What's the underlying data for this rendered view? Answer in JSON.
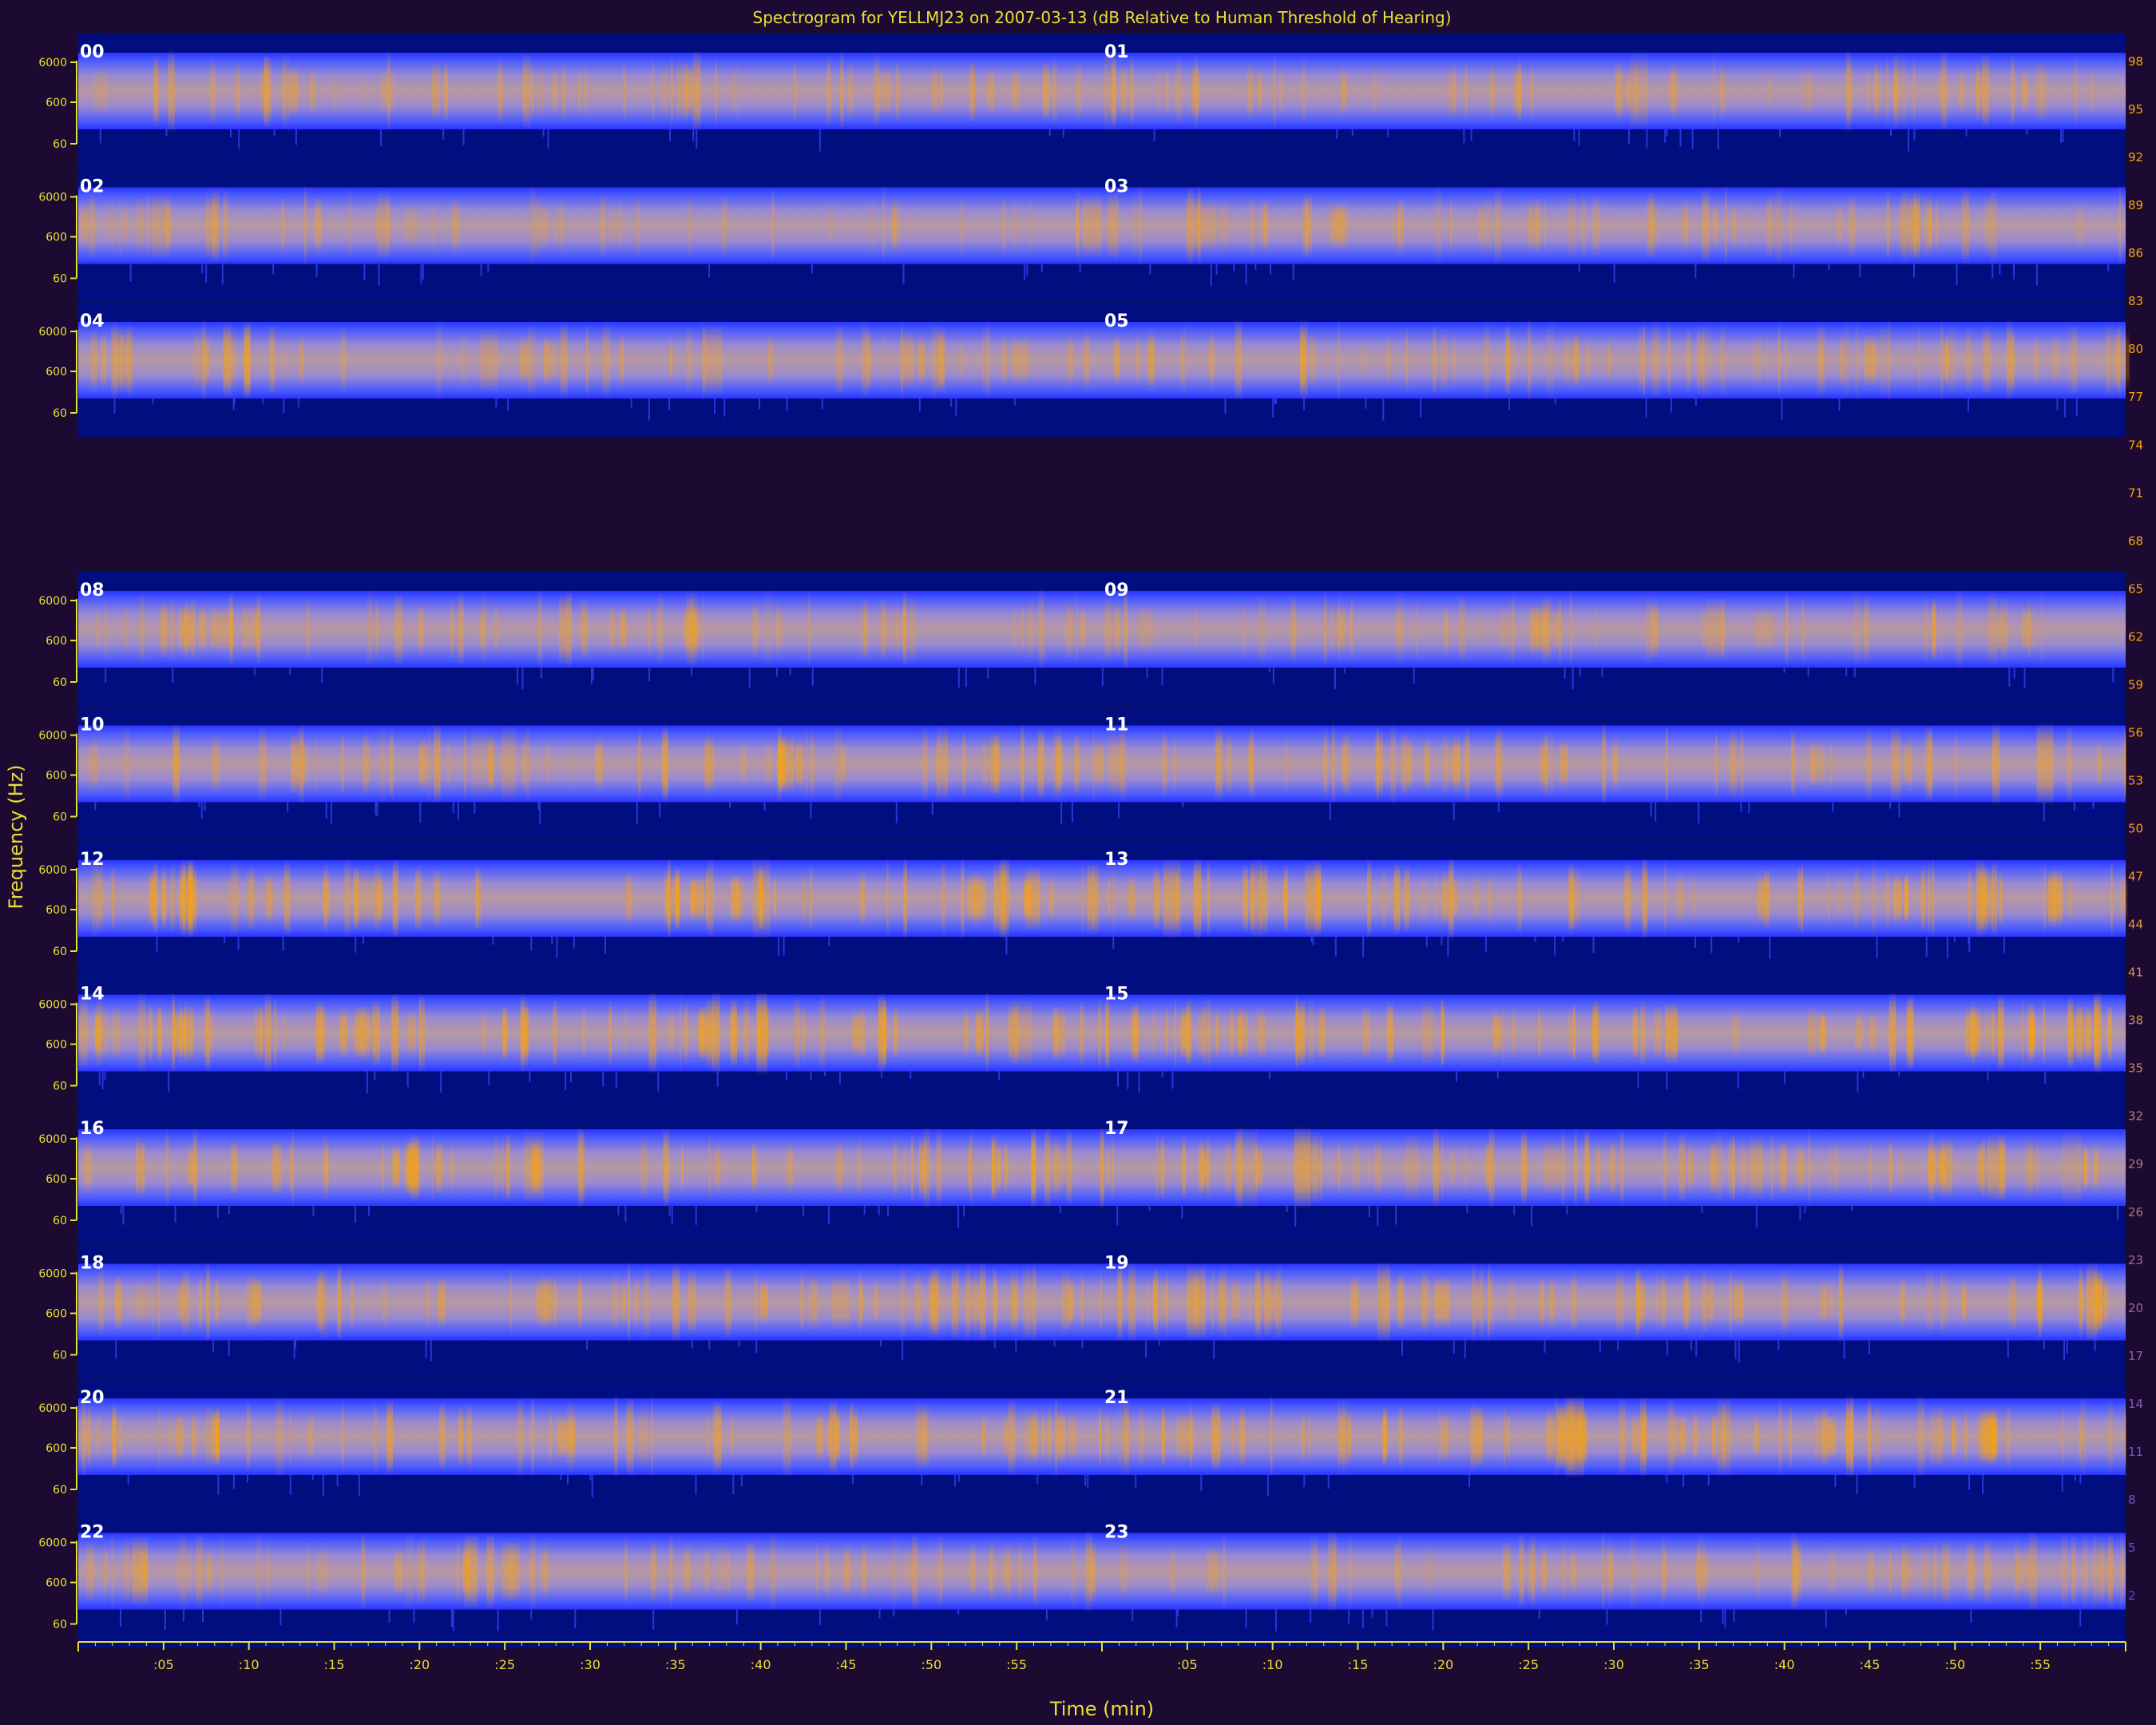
{
  "chart_data": {
    "type": "heatmap",
    "title": "Spectrogram for YELLMJ23 on 2007-03-13 (dB Relative to Human Threshold of Hearing)",
    "xlabel": "Time (min)",
    "ylabel": "Frequency (Hz)",
    "x_tick_labels_left": [
      ":05",
      ":10",
      ":15",
      ":20",
      ":25",
      ":30",
      ":35",
      ":40",
      ":45",
      ":50",
      ":55"
    ],
    "x_tick_labels_right": [
      ":05",
      ":10",
      ":15",
      ":20",
      ":25",
      ":30",
      ":35",
      ":40",
      ":45",
      ":50",
      ":55"
    ],
    "y_tick_labels": [
      "6000",
      "600",
      "60"
    ],
    "hours_shown": [
      "00",
      "01",
      "02",
      "03",
      "04",
      "05",
      "08",
      "09",
      "10",
      "11",
      "12",
      "13",
      "14",
      "15",
      "16",
      "17",
      "18",
      "19",
      "20",
      "21",
      "22",
      "23"
    ],
    "row_pairs": [
      {
        "left": "00",
        "right": "01",
        "intensity": 0.55
      },
      {
        "left": "02",
        "right": "03",
        "intensity": 0.5
      },
      {
        "left": "04",
        "right": "05",
        "intensity": 0.58
      },
      null,
      {
        "left": "08",
        "right": "09",
        "intensity": 0.55
      },
      {
        "left": "10",
        "right": "11",
        "intensity": 0.6
      },
      {
        "left": "12",
        "right": "13",
        "intensity": 0.75
      },
      {
        "left": "14",
        "right": "15",
        "intensity": 0.78
      },
      {
        "left": "16",
        "right": "17",
        "intensity": 0.72
      },
      {
        "left": "18",
        "right": "19",
        "intensity": 0.68
      },
      {
        "left": "20",
        "right": "21",
        "intensity": 0.7
      },
      {
        "left": "22",
        "right": "23",
        "intensity": 0.55
      }
    ],
    "colorbar_ticks": [
      "98",
      "95",
      "92",
      "89",
      "86",
      "83",
      "80",
      "77",
      "74",
      "71",
      "68",
      "65",
      "62",
      "59",
      "56",
      "53",
      "50",
      "47",
      "44",
      "41",
      "38",
      "35",
      "32",
      "29",
      "26",
      "23",
      "20",
      "17",
      "14",
      "11",
      "8",
      "5",
      "2"
    ],
    "colorbar_range_db": [
      2,
      98
    ],
    "colors": {
      "background": "#1c0a33",
      "plot_background": "#000e80",
      "band_low": "#2a33ff",
      "band_high": "#ffa200",
      "axis": "#e8e030",
      "hour_label": "#ffffff"
    }
  }
}
